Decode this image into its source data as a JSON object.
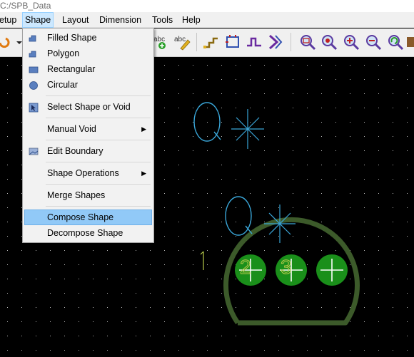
{
  "window": {
    "title": "C:/SPB_Data"
  },
  "menubar": {
    "items": [
      {
        "label": "etup"
      },
      {
        "label": "Shape"
      },
      {
        "label": "Layout"
      },
      {
        "label": "Dimension"
      },
      {
        "label": "Tools"
      },
      {
        "label": "Help"
      }
    ]
  },
  "shape_menu": {
    "items": [
      {
        "label": "Filled Shape",
        "icon": "filled-shape-icon"
      },
      {
        "label": "Polygon",
        "icon": "polygon-icon"
      },
      {
        "label": "Rectangular",
        "icon": "rectangle-icon"
      },
      {
        "label": "Circular",
        "icon": "circle-icon"
      },
      {
        "label": "Select Shape or Void",
        "icon": "select-shape-icon"
      },
      {
        "label": "Manual Void",
        "submenu": true
      },
      {
        "label": "Edit Boundary",
        "icon": "edit-boundary-icon"
      },
      {
        "label": "Shape Operations",
        "submenu": true
      },
      {
        "label": "Merge Shapes"
      },
      {
        "label": "Compose Shape",
        "highlighted": true
      },
      {
        "label": "Decompose Shape"
      }
    ]
  },
  "toolbar": {
    "icons": [
      "text-icon",
      "edit-text-icon",
      "add-connect-icon",
      "delay-tune-icon",
      "slide-icon",
      "route-icon",
      "zoom-fit-icon",
      "zoom-in-icon",
      "zoom-out-icon",
      "zoom-previous-icon",
      "redraw-icon"
    ]
  },
  "canvas": {
    "labels": {
      "ref_top": "Q",
      "ref_mid": "Q",
      "pin_number": "1",
      "pin_two": "2",
      "pin_three": "3"
    },
    "colors": {
      "background": "#000000",
      "grid_dot": "#b8b8b8",
      "outline": "#3c5a2a",
      "pad": "#1a8f1a",
      "refdes": "#3aa6d8",
      "pin_text": "#b6c94a"
    }
  }
}
